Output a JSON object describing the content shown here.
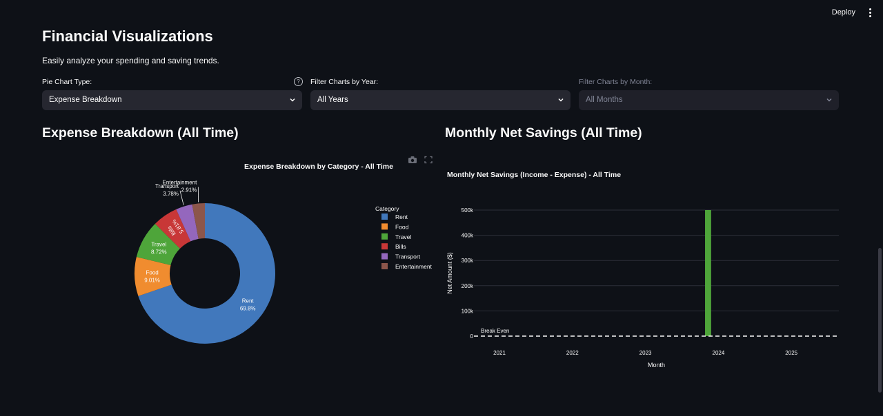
{
  "header": {
    "deploy_label": "Deploy"
  },
  "page": {
    "title": "Financial Visualizations",
    "subtitle": "Easily analyze your spending and saving trends."
  },
  "filters": {
    "pie_type": {
      "label": "Pie Chart Type:",
      "value": "Expense Breakdown",
      "help": "?"
    },
    "year": {
      "label": "Filter Charts by Year:",
      "value": "All Years"
    },
    "month": {
      "label": "Filter Charts by Month:",
      "value": "All Months",
      "disabled": true
    }
  },
  "sections": {
    "left_heading": "Expense Breakdown (All Time)",
    "right_heading": "Monthly Net Savings (All Time)"
  },
  "chart_data": [
    {
      "type": "pie",
      "title": "Expense Breakdown by Category - All Time",
      "hole": true,
      "legend_title": "Category",
      "legend_position": "right",
      "categories": [
        "Rent",
        "Food",
        "Travel",
        "Bills",
        "Transport",
        "Entertainment"
      ],
      "values": [
        69.8,
        9.01,
        8.72,
        5.81,
        3.78,
        2.91
      ],
      "labels": [
        "69.8%",
        "9.01%",
        "8.72%",
        "5.81%",
        "3.78%",
        "2.91%"
      ],
      "colors": [
        "#4178bc",
        "#f08c2f",
        "#4ea53a",
        "#c83737",
        "#9467bd",
        "#8c564b"
      ]
    },
    {
      "type": "bar",
      "title": "Monthly Net Savings (Income - Expense) - All Time",
      "xlabel": "Month",
      "ylabel": "Net Amount ($)",
      "x_ticks": [
        "2021",
        "2022",
        "2023",
        "2024",
        "2025"
      ],
      "y_ticks": [
        "0",
        "100k",
        "200k",
        "300k",
        "400k",
        "500k"
      ],
      "ylim": [
        0,
        500000
      ],
      "xlim": [
        "2021-01",
        "2025-12"
      ],
      "bars": [
        {
          "x": "2024-03",
          "value": 500000
        }
      ],
      "bar_color": "#4ea53a",
      "reference_line": {
        "y": 0,
        "label": "Break Even",
        "style": "dashed"
      },
      "grid": true
    }
  ]
}
